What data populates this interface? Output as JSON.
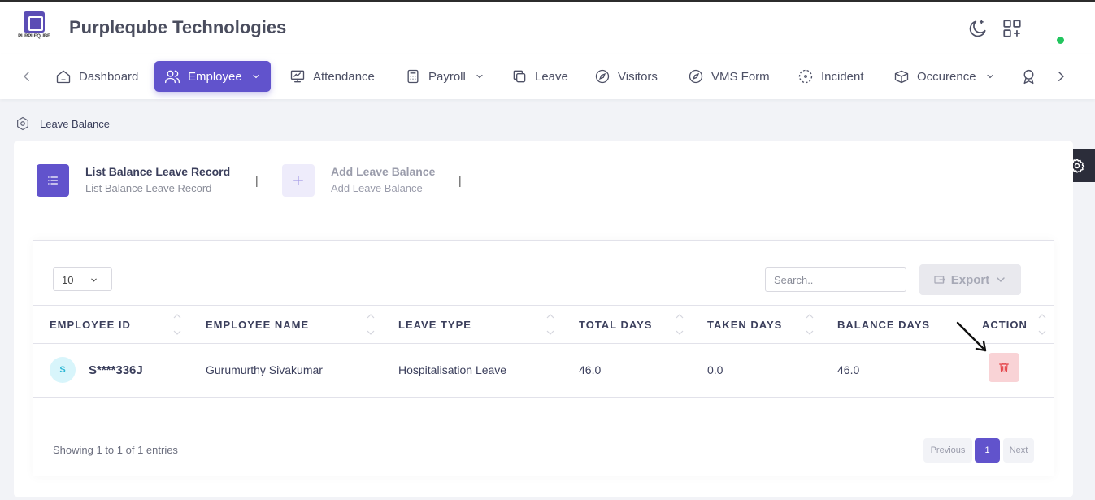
{
  "header": {
    "logo_text": "PURPLEQUBE",
    "company_name": "Purpleqube Technologies",
    "icons": [
      "moon-icon",
      "apps-add-icon"
    ],
    "status_color": "#22c55e"
  },
  "nav": {
    "items": [
      {
        "label": "Dashboard",
        "icon": "home-icon"
      },
      {
        "label": "Employee",
        "icon": "users-icon",
        "active": true
      },
      {
        "label": "Attendance",
        "icon": "monitor-icon"
      },
      {
        "label": "Payroll",
        "icon": "calculator-icon"
      },
      {
        "label": "Leave",
        "icon": "copy-icon"
      },
      {
        "label": "Visitors",
        "icon": "compass-icon"
      },
      {
        "label": "VMS Form",
        "icon": "compass-icon"
      },
      {
        "label": "Incident",
        "icon": "focus-icon"
      },
      {
        "label": "Occurence",
        "icon": "box-icon"
      }
    ],
    "accent_color": "#6153cc"
  },
  "breadcrumb": {
    "label": "Leave Balance"
  },
  "tabs": {
    "list": {
      "title": "List Balance Leave Record",
      "subtitle": "List Balance Leave Record"
    },
    "add": {
      "title": "Add Leave Balance",
      "subtitle": "Add Leave Balance"
    },
    "separator": "|"
  },
  "table_controls": {
    "page_length": "10",
    "search_placeholder": "Search..",
    "export_label": "Export"
  },
  "table": {
    "columns": [
      "EMPLOYEE ID",
      "EMPLOYEE NAME",
      "LEAVE TYPE",
      "TOTAL DAYS",
      "TAKEN DAYS",
      "BALANCE DAYS",
      "ACTION"
    ],
    "rows": [
      {
        "avatar": "S",
        "employee_id": "S****336J",
        "employee_name": "Gurumurthy Sivakumar",
        "leave_type": "Hospitalisation Leave",
        "total_days": "46.0",
        "taken_days": "0.0",
        "balance_days": "46.0"
      }
    ]
  },
  "footer": {
    "info": "Showing 1 to 1 of 1 entries",
    "previous": "Previous",
    "page": "1",
    "next": "Next"
  }
}
